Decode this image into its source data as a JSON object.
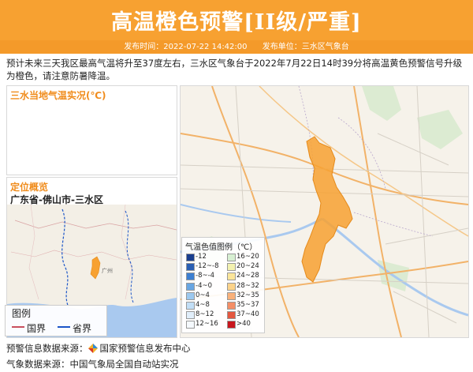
{
  "header": {
    "title": "高温橙色预警[II级/严重]",
    "publish_time_label": "发布时间：2022-07-22 14:42:00",
    "publisher_label": "发布单位：三水区气象台"
  },
  "description": "预计未来三天我区最高气温将升至37度左右，三水区气象台于2022年7月22日14时39分将高温黄色预警信号升级为橙色，请注意防暑降温。",
  "temp_panel": {
    "title": "三水当地气温实况(℃)"
  },
  "location_panel": {
    "title": "定位概览",
    "location": "广东省-佛山市-三水区"
  },
  "mini_legend": {
    "title": "图例",
    "items": [
      {
        "label": "国界",
        "color": "#c94f5f"
      },
      {
        "label": "省界",
        "color": "#1b55c8"
      }
    ]
  },
  "map_legend": {
    "title": "气温色值图例（℃）",
    "items": [
      {
        "label": "-12",
        "color": "#1a3f8f"
      },
      {
        "label": "-12~-8",
        "color": "#2a5fb3"
      },
      {
        "label": "-8~-4",
        "color": "#3d7fd1"
      },
      {
        "label": "-4~0",
        "color": "#69a6e3"
      },
      {
        "label": "0~4",
        "color": "#9cc8ef"
      },
      {
        "label": "4~8",
        "color": "#c2def6"
      },
      {
        "label": "8~12",
        "color": "#e1eefa"
      },
      {
        "label": "12~16",
        "color": "#f5f9fd"
      },
      {
        "label": "16~20",
        "color": "#d7efd2"
      },
      {
        "label": "20~24",
        "color": "#f3f1b0"
      },
      {
        "label": "24~28",
        "color": "#fbe59a"
      },
      {
        "label": "28~32",
        "color": "#fcd38a"
      },
      {
        "label": "32~35",
        "color": "#f9b17a"
      },
      {
        "label": "35~37",
        "color": "#f48e66"
      },
      {
        "label": "37~40",
        "color": "#e4573f"
      },
      {
        "label": ">40",
        "color": "#c8161d"
      }
    ]
  },
  "footer": {
    "warning_source": "预警信息数据来源：",
    "warning_source_name": "国家预警信息发布中心",
    "weather_source": "气象数据来源：中国气象局全国自动站实况"
  },
  "map": {
    "small_city_label": "广州"
  }
}
